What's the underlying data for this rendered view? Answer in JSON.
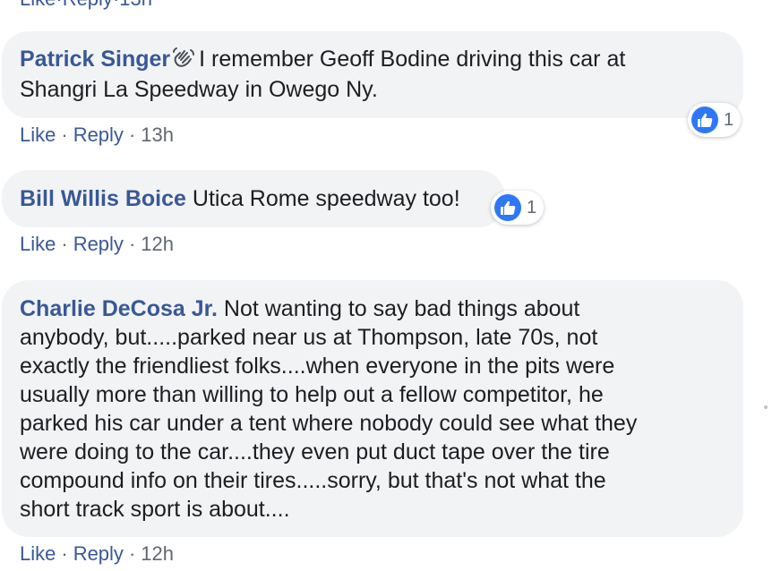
{
  "top_actions": {
    "like": "Like",
    "reply": "Reply",
    "time": "13h"
  },
  "comments": [
    {
      "author": "Patrick Singer",
      "text": "I remember Geoff Bodine driving this car at Shangri La Speedway in Owego Ny.",
      "line1": "I remember Geoff Bodine driving this car at",
      "line2": "Shangri La Speedway in Owego Ny.",
      "like": "Like",
      "reply": "Reply",
      "time": "13h",
      "reaction_count": "1",
      "badge_icon": "waving-hand-icon"
    },
    {
      "author": "Bill Willis Boice",
      "text": "Utica Rome speedway too!",
      "like": "Like",
      "reply": "Reply",
      "time": "12h",
      "reaction_count": "1"
    },
    {
      "author": "Charlie DeCosa Jr.",
      "text": "Not wanting to say bad things about anybody, but.....parked near us at Thompson, late 70s, not exactly the friendliest folks....when everyone in the pits were usually more than willing to help out a fellow competitor, he parked his car under a tent where nobody could see what they were doing to the car....they even put duct tape over the tire compound info on their tires.....sorry, but that's not what the short track sport is about....",
      "lines": [
        "Not wanting to say bad things about",
        "anybody, but.....parked near us at Thompson, late 70s, not",
        "exactly the friendliest folks....when everyone in the pits were",
        "usually more than willing to help out a fellow competitor, he",
        "parked his car under a tent where nobody could see what they",
        "were doing to the car....they even put duct tape over the tire",
        "compound info on their tires.....sorry, but that's not what the",
        "short track sport is about...."
      ],
      "like": "Like",
      "reply": "Reply",
      "time": "12h"
    }
  ],
  "colors": {
    "author": "#385898",
    "bubble": "#f2f3f5",
    "meta": "#606770",
    "like_badge": "#2e78f7"
  },
  "icons": {
    "like": "thumbs-up-icon",
    "badge": "waving-hand-icon"
  }
}
